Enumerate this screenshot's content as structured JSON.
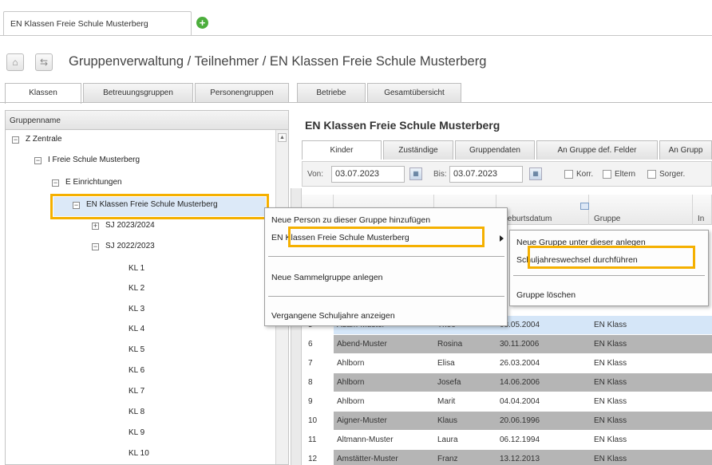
{
  "top_tab": {
    "label": "EN Klassen Freie Schule Musterberg",
    "add_icon": "plus-icon"
  },
  "breadcrumb": {
    "text": "Gruppenverwaltung / Teilnehmer / EN Klassen Freie Schule Musterberg",
    "home_icon": "home-icon",
    "refresh_icon": "refresh-icon"
  },
  "main_tabs": [
    "Klassen",
    "Betreuungsgruppen",
    "Personengruppen",
    "Betriebe",
    "Gesamtübersicht"
  ],
  "tree": {
    "header": "Gruppenname",
    "nodes": [
      {
        "label": "Z Zentrale",
        "expander": "−"
      },
      {
        "label": "I Freie Schule Musterberg",
        "expander": "−"
      },
      {
        "label": "E Einrichtungen",
        "expander": "−"
      },
      {
        "label": "EN Klassen Freie Schule Musterberg",
        "expander": "−"
      },
      {
        "label": "SJ 2023/2024",
        "expander": "+"
      },
      {
        "label": "SJ 2022/2023",
        "expander": "−"
      },
      {
        "label": "KL 1"
      },
      {
        "label": "KL 2"
      },
      {
        "label": "KL 3"
      },
      {
        "label": "KL 4"
      },
      {
        "label": "KL 5"
      },
      {
        "label": "KL 6"
      },
      {
        "label": "KL 7"
      },
      {
        "label": "KL 8"
      },
      {
        "label": "KL 9"
      },
      {
        "label": "KL 10"
      }
    ]
  },
  "right": {
    "title": "EN Klassen Freie Schule Musterberg",
    "tabs": [
      "Kinder",
      "Zuständige",
      "Gruppendaten",
      "An Gruppe def. Felder",
      "An Grupp"
    ],
    "filter": {
      "von_label": "Von:",
      "von_value": "03.07.2023",
      "bis_label": "Bis:",
      "bis_value": "03.07.2023",
      "checkboxes": [
        "Korr.",
        "Eltern",
        "Sorger."
      ]
    },
    "grid_columns": [
      "",
      "",
      "",
      "Geburtsdatum",
      "Gruppe",
      "In"
    ],
    "rows": [
      {
        "n": "5",
        "name": "Adam-Muster",
        "first": "Theo",
        "dob": "08.05.2004",
        "group": "EN Klass"
      },
      {
        "n": "6",
        "name": "Abend-Muster",
        "first": "Rosina",
        "dob": "30.11.2006",
        "group": "EN Klass"
      },
      {
        "n": "7",
        "name": "Ahlborn",
        "first": "Elisa",
        "dob": "26.03.2004",
        "group": "EN Klass"
      },
      {
        "n": "8",
        "name": "Ahlborn",
        "first": "Josefa",
        "dob": "14.06.2006",
        "group": "EN Klass"
      },
      {
        "n": "9",
        "name": "Ahlborn",
        "first": "Marit",
        "dob": "04.04.2004",
        "group": "EN Klass"
      },
      {
        "n": "10",
        "name": "Aigner-Muster",
        "first": "Klaus",
        "dob": "20.06.1996",
        "group": "EN Klass"
      },
      {
        "n": "11",
        "name": "Altmann-Muster",
        "first": "Laura",
        "dob": "06.12.1994",
        "group": "EN Klass"
      },
      {
        "n": "12",
        "name": "Amstätter-Muster",
        "first": "Franz",
        "dob": "13.12.2013",
        "group": "EN Klass"
      }
    ]
  },
  "context_menu": {
    "items": [
      "Neue Person zu dieser Gruppe hinzufügen",
      "EN Klassen Freie Schule Musterberg",
      "Neue Sammelgruppe anlegen",
      "Vergangene Schuljahre anzeigen"
    ]
  },
  "submenu": {
    "items": [
      "Neue Gruppe unter dieser anlegen",
      "Schuljahreswechsel durchführen",
      "Gruppe löschen"
    ]
  },
  "colors": {
    "highlight": "#f5b000",
    "add_green": "#4cae3c",
    "selection": "#dce9f8"
  }
}
